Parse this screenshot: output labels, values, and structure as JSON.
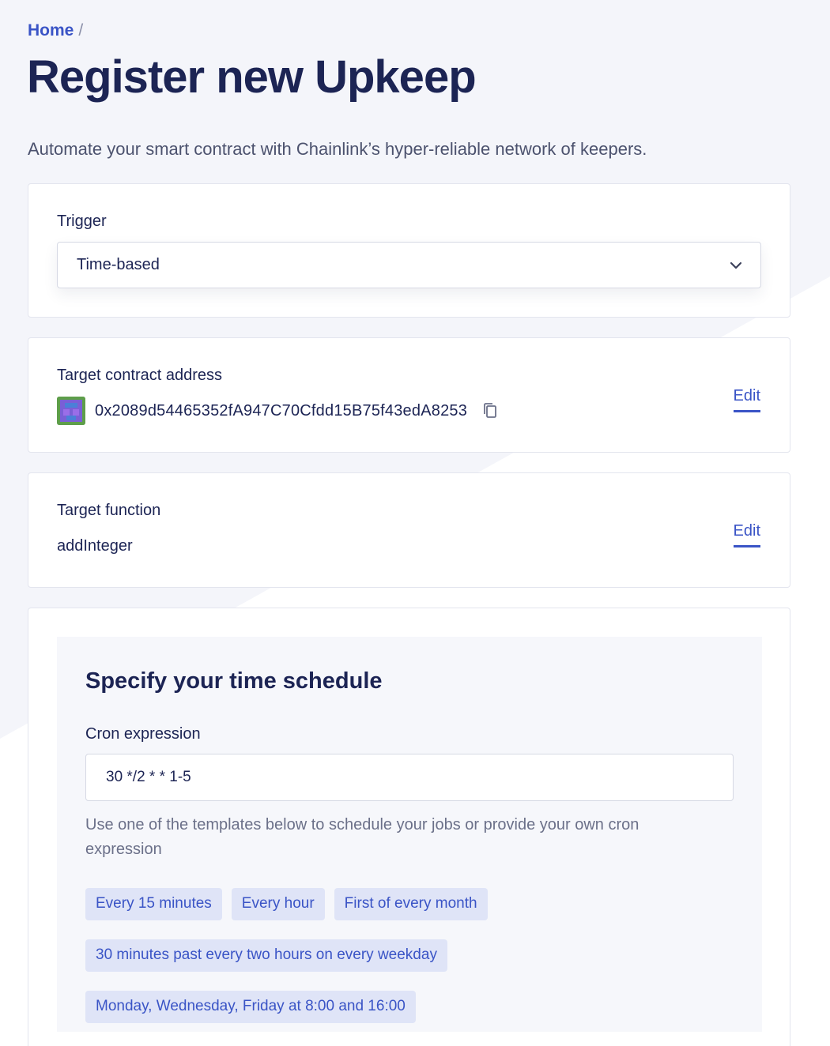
{
  "breadcrumb": {
    "home": "Home",
    "separator": "/"
  },
  "page_title": "Register new Upkeep",
  "subtitle": "Automate your smart contract with Chainlink’s hyper-reliable network of keepers.",
  "trigger": {
    "label": "Trigger",
    "selected": "Time-based",
    "icon": "chevron-down-icon"
  },
  "target_contract": {
    "label": "Target contract address",
    "address": "0x2089d54465352fA947C70Cfdd15B75f43edA8253",
    "edit_label": "Edit",
    "copy_icon": "copy-icon"
  },
  "target_function": {
    "label": "Target function",
    "value": "addInteger",
    "edit_label": "Edit"
  },
  "schedule": {
    "title": "Specify your time schedule",
    "cron_label": "Cron expression",
    "cron_value": "30 */2 * * 1-5",
    "help_text": "Use one of the templates below to schedule your jobs or provide your own cron expression",
    "templates": [
      "Every 15 minutes",
      "Every hour",
      "First of every month",
      "30 minutes past every two hours on every weekday",
      "Monday, Wednesday, Friday at 8:00 and 16:00"
    ]
  },
  "colors": {
    "accent": "#3a54c6",
    "title": "#1c2454",
    "chip_bg": "#dfe4f7",
    "background": "#f4f5fa"
  }
}
